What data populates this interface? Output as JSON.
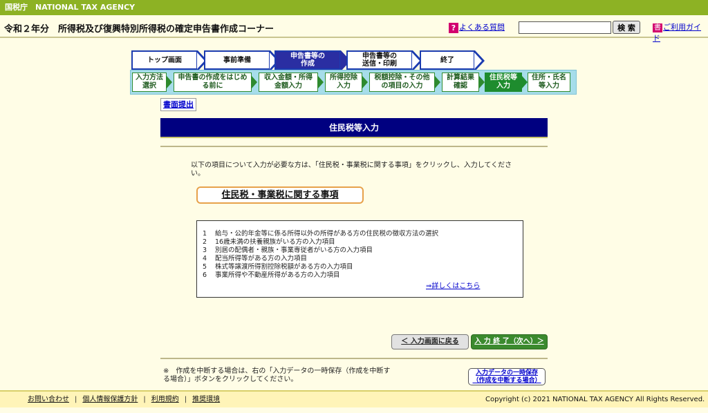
{
  "agency": "国税庁　NATIONAL TAX AGENCY",
  "header": {
    "title": "令和２年分　所得税及び復興特別所得税の確定申告書作成コーナー",
    "faq_icon": "?",
    "faq": "よくある質問",
    "search_placeholder": "",
    "search_button": "検 索",
    "guide_icon": "書",
    "guide": "ご利用ガイド"
  },
  "steps": [
    {
      "label": "トップ画面"
    },
    {
      "label": "事前準備"
    },
    {
      "label": "申告書等の\n作成",
      "active": true
    },
    {
      "label": "申告書等の\n送信・印刷"
    },
    {
      "label": "終了"
    }
  ],
  "substeps": [
    {
      "label": "入力方法\n選択"
    },
    {
      "label": "申告書の作成をはじめ\nる前に"
    },
    {
      "label": "収入金額・所得\n金額入力"
    },
    {
      "label": "所得控除\n入力"
    },
    {
      "label": "税額控除・その他\nの項目の入力"
    },
    {
      "label": "計算結果\n確認"
    },
    {
      "label": "住民税等\n入力",
      "active": true
    },
    {
      "label": "住所・氏名\n等入力"
    }
  ],
  "submit_tab": "書面提出",
  "page_title": "住民税等入力",
  "intro": "以下の項目について入力が必要な方は、「住民税・事業税に関する事項」をクリックし、入力してください。",
  "main_button": "住民税・事業税に関する事項",
  "items": [
    {
      "num": "1",
      "text": "給与・公的年金等に係る所得以外の所得がある方の住民税の徴収方法の選択"
    },
    {
      "num": "2",
      "text": "16歳未満の扶養親族がいる方の入力項目"
    },
    {
      "num": "3",
      "text": "別居の配偶者・親族・事業専従者がいる方の入力項目"
    },
    {
      "num": "4",
      "text": "配当所得等がある方の入力項目"
    },
    {
      "num": "5",
      "text": "株式等譲渡所得割控除税額がある方の入力項目"
    },
    {
      "num": "6",
      "text": "事業所得や不動産所得がある方の入力項目"
    }
  ],
  "details_link": "⇒詳しくはこちら",
  "back_button": "＜ 入力画面に戻る",
  "next_button": "入 力 終 了（次へ）＞",
  "note": "※　作成を中断する場合は、右の「入力データの一時保存（作成を中断する場合）」ボタンをクリックしてください。",
  "save_button_line1": "入力データの一時保存",
  "save_button_line2": "（作成を中断する場合）",
  "footer": {
    "links": [
      "お問い合わせ",
      "個人情報保護方針",
      "利用規約",
      "推奨環境"
    ],
    "separator": "|",
    "copyright": "Copyright (c) 2021 NATIONAL TAX AGENCY All Rights Reserved."
  },
  "colors": {
    "topbar": "#8db224",
    "step_active": "#2a2ea2",
    "substep_active": "#1e8c2e",
    "banner": "#000080"
  }
}
